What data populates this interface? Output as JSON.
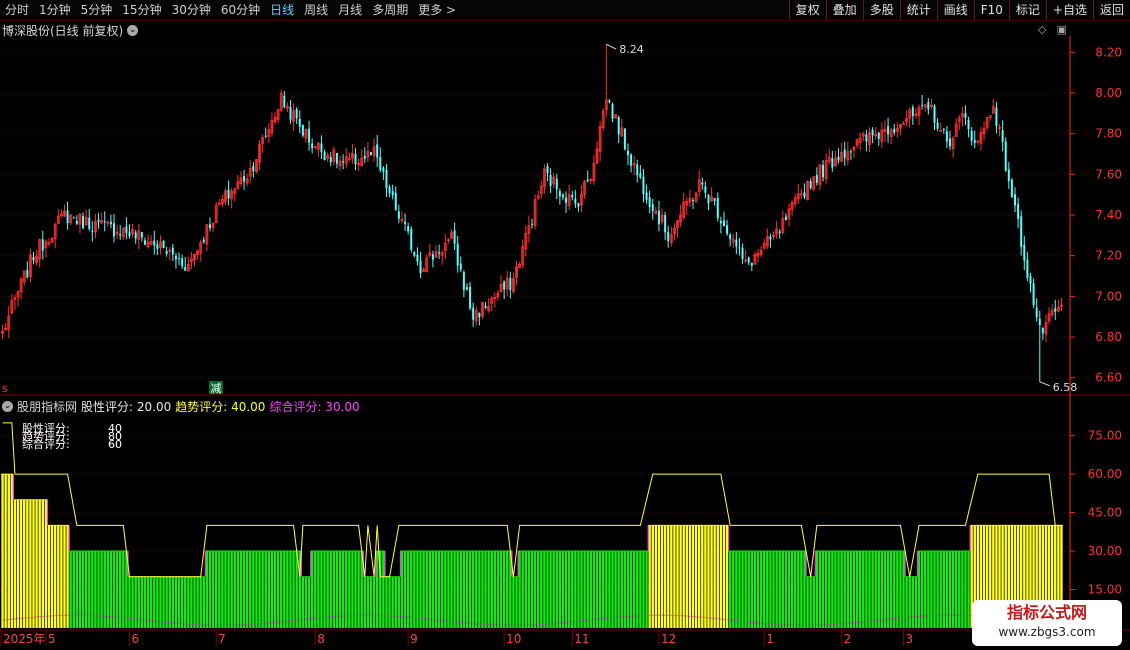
{
  "toolbar": {
    "tabs": [
      "分时",
      "1分钟",
      "5分钟",
      "15分钟",
      "30分钟",
      "60分钟",
      "日线",
      "周线",
      "月线",
      "多周期",
      "更多 >"
    ],
    "active_tab": 6,
    "right_buttons": [
      "复权",
      "叠加",
      "多股",
      "统计",
      "画线",
      "F10",
      "标记",
      "+自选",
      "返回"
    ]
  },
  "main_panel": {
    "title": "博深股份(日线 前复权)",
    "high_label": "8.24",
    "low_label": "6.58",
    "marker_s": "s",
    "marker_jian": "减",
    "colors": {
      "up": "#ff3030",
      "down": "#54ffff",
      "axis": "#ff2020",
      "grid": "#5a0000"
    }
  },
  "indicator_panel": {
    "name": "股朋指标网",
    "stat1_label": "股性评分: 20.00",
    "stat2_label": "趋势评分: 40.00",
    "stat3_label": "综合评分: 30.00",
    "legend_rows": [
      {
        "label": "股性评分:",
        "value": "40"
      },
      {
        "label": "趋势评分:",
        "value": "80"
      },
      {
        "label": "综合评分:",
        "value": "60"
      }
    ],
    "colors": {
      "yellow": "#ffff20",
      "green": "#10ee10",
      "line": "#ffff40",
      "magenta": "#ff30ff"
    }
  },
  "date_axis": {
    "labels": [
      {
        "text": "2025年",
        "idx": 0
      },
      {
        "text": "5",
        "idx": 14
      },
      {
        "text": "6",
        "idx": 41
      },
      {
        "text": "7",
        "idx": 69
      },
      {
        "text": "8",
        "idx": 101
      },
      {
        "text": "9",
        "idx": 131
      },
      {
        "text": "10",
        "idx": 162
      },
      {
        "text": "11",
        "idx": 184
      },
      {
        "text": "12",
        "idx": 212
      },
      {
        "text": "1",
        "idx": 246
      },
      {
        "text": "2",
        "idx": 271
      },
      {
        "text": "3",
        "idx": 291
      }
    ]
  },
  "watermark": {
    "title": "指标公式网",
    "url": "www.zbgs3.com"
  },
  "chart_data": [
    {
      "type": "candlestick",
      "title": "博深股份(日线 前复权)",
      "y_ticks": [
        6.6,
        6.8,
        7.0,
        7.2,
        7.4,
        7.6,
        7.8,
        8.0,
        8.2
      ],
      "ylim": [
        6.52,
        8.28
      ],
      "n_bars": 343,
      "high": 8.24,
      "low": 6.58,
      "close_anchors": [
        [
          0,
          6.82
        ],
        [
          5,
          7.02
        ],
        [
          10,
          7.2
        ],
        [
          20,
          7.4
        ],
        [
          30,
          7.35
        ],
        [
          40,
          7.32
        ],
        [
          50,
          7.25
        ],
        [
          60,
          7.15
        ],
        [
          70,
          7.45
        ],
        [
          80,
          7.62
        ],
        [
          90,
          7.97
        ],
        [
          100,
          7.75
        ],
        [
          110,
          7.65
        ],
        [
          120,
          7.7
        ],
        [
          125,
          7.5
        ],
        [
          135,
          7.15
        ],
        [
          145,
          7.28
        ],
        [
          152,
          6.9
        ],
        [
          165,
          7.08
        ],
        [
          175,
          7.6
        ],
        [
          185,
          7.45
        ],
        [
          190,
          7.6
        ],
        [
          195,
          7.98
        ],
        [
          205,
          7.6
        ],
        [
          215,
          7.3
        ],
        [
          225,
          7.55
        ],
        [
          230,
          7.45
        ],
        [
          240,
          7.15
        ],
        [
          250,
          7.3
        ],
        [
          260,
          7.55
        ],
        [
          270,
          7.7
        ],
        [
          280,
          7.78
        ],
        [
          290,
          7.86
        ],
        [
          300,
          7.92
        ],
        [
          305,
          7.75
        ],
        [
          310,
          7.88
        ],
        [
          315,
          7.75
        ],
        [
          320,
          7.95
        ],
        [
          328,
          7.35
        ],
        [
          335,
          6.82
        ],
        [
          342,
          6.95
        ]
      ]
    },
    {
      "type": "bar",
      "title": "股朋指标网",
      "y_ticks": [
        15.0,
        30.0,
        45.0,
        60.0,
        75.0
      ],
      "ylim": [
        0,
        85
      ],
      "series": [
        {
          "name": "综合评分",
          "segments": [
            {
              "start": 0,
              "end": 3,
              "value": 60,
              "color": "yellow"
            },
            {
              "start": 4,
              "end": 14,
              "value": 50,
              "color": "yellow"
            },
            {
              "start": 15,
              "end": 21,
              "value": 40,
              "color": "yellow"
            },
            {
              "start": 22,
              "end": 40,
              "value": 30,
              "color": "green"
            },
            {
              "start": 41,
              "end": 65,
              "value": 20,
              "color": "green"
            },
            {
              "start": 66,
              "end": 96,
              "value": 30,
              "color": "green"
            },
            {
              "start": 97,
              "end": 99,
              "value": 20,
              "color": "green"
            },
            {
              "start": 100,
              "end": 116,
              "value": 30,
              "color": "green"
            },
            {
              "start": 117,
              "end": 120,
              "value": 20,
              "color": "green"
            },
            {
              "start": 121,
              "end": 123,
              "value": 30,
              "color": "green"
            },
            {
              "start": 124,
              "end": 128,
              "value": 20,
              "color": "green"
            },
            {
              "start": 129,
              "end": 164,
              "value": 30,
              "color": "green"
            },
            {
              "start": 165,
              "end": 166,
              "value": 20,
              "color": "green"
            },
            {
              "start": 167,
              "end": 208,
              "value": 30,
              "color": "green"
            },
            {
              "start": 209,
              "end": 234,
              "value": 40,
              "color": "yellow"
            },
            {
              "start": 235,
              "end": 259,
              "value": 30,
              "color": "green"
            },
            {
              "start": 260,
              "end": 262,
              "value": 20,
              "color": "green"
            },
            {
              "start": 263,
              "end": 291,
              "value": 30,
              "color": "green"
            },
            {
              "start": 292,
              "end": 295,
              "value": 20,
              "color": "green"
            },
            {
              "start": 296,
              "end": 312,
              "value": 30,
              "color": "green"
            },
            {
              "start": 313,
              "end": 342,
              "value": 40,
              "color": "yellow"
            }
          ]
        },
        {
          "name": "趋势评分",
          "line_points": [
            [
              0,
              80
            ],
            [
              3,
              80
            ],
            [
              4,
              60
            ],
            [
              21,
              60
            ],
            [
              24,
              40
            ],
            [
              39,
              40
            ],
            [
              41,
              20
            ],
            [
              64,
              20
            ],
            [
              66,
              40
            ],
            [
              94,
              40
            ],
            [
              96,
              20
            ],
            [
              97,
              40
            ],
            [
              115,
              40
            ],
            [
              117,
              20
            ],
            [
              118,
              40
            ],
            [
              120,
              20
            ],
            [
              121,
              40
            ],
            [
              122,
              20
            ],
            [
              125,
              20
            ],
            [
              128,
              40
            ],
            [
              163,
              40
            ],
            [
              165,
              20
            ],
            [
              167,
              40
            ],
            [
              206,
              40
            ],
            [
              210,
              60
            ],
            [
              232,
              60
            ],
            [
              235,
              40
            ],
            [
              258,
              40
            ],
            [
              261,
              20
            ],
            [
              263,
              40
            ],
            [
              290,
              40
            ],
            [
              293,
              20
            ],
            [
              296,
              40
            ],
            [
              311,
              40
            ],
            [
              315,
              60
            ],
            [
              338,
              60
            ],
            [
              340,
              40
            ],
            [
              342,
              40
            ]
          ]
        }
      ]
    }
  ]
}
